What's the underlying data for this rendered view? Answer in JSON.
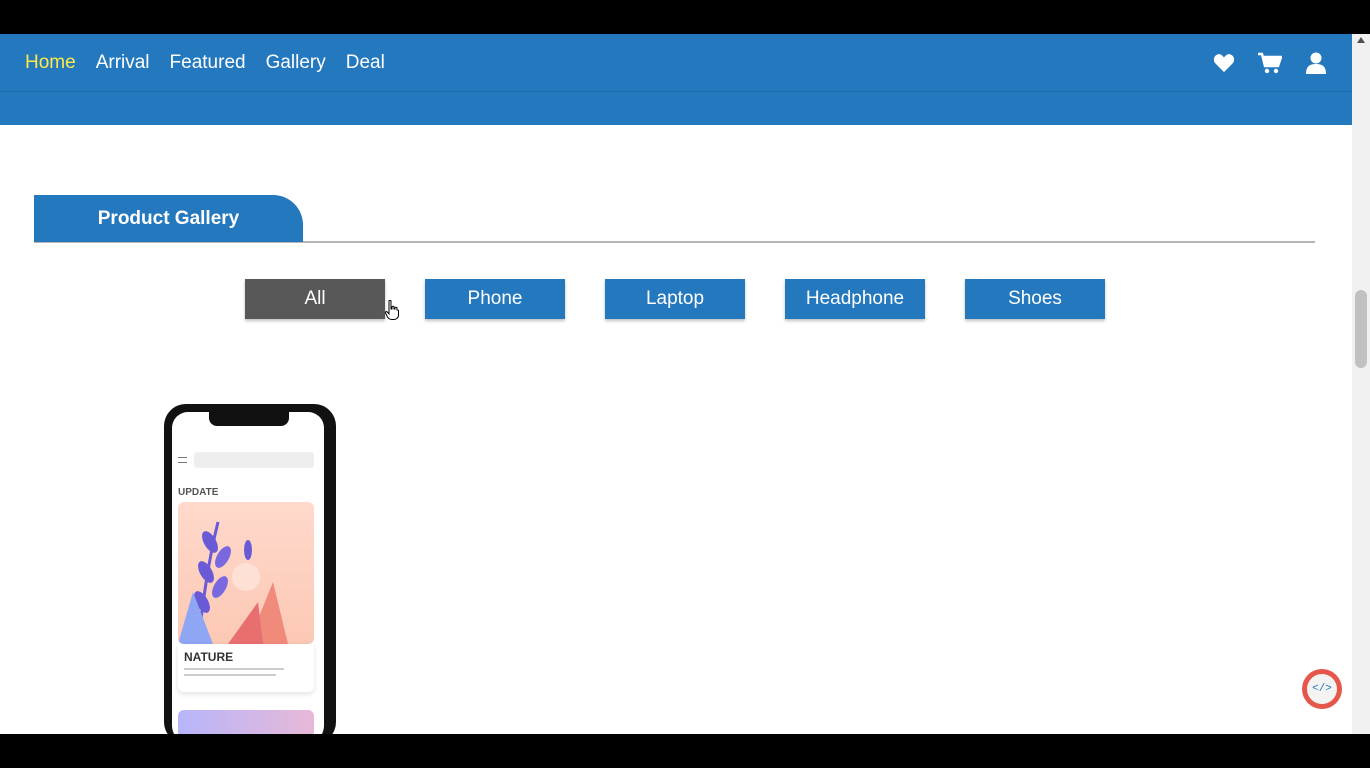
{
  "nav": {
    "links": [
      {
        "label": "Home",
        "active": true
      },
      {
        "label": "Arrival",
        "active": false
      },
      {
        "label": "Featured",
        "active": false
      },
      {
        "label": "Gallery",
        "active": false
      },
      {
        "label": "Deal",
        "active": false
      }
    ],
    "icons": [
      "heart-icon",
      "cart-icon",
      "user-icon"
    ],
    "background_color": "#2478bd",
    "active_color": "#ffe94a"
  },
  "section": {
    "title": "Product Gallery"
  },
  "filters": [
    {
      "label": "All",
      "selected": true
    },
    {
      "label": "Phone",
      "selected": false
    },
    {
      "label": "Laptop",
      "selected": false
    },
    {
      "label": "Headphone",
      "selected": false
    },
    {
      "label": "Shoes",
      "selected": false
    }
  ],
  "filter_colors": {
    "selected": "#585858",
    "default": "#2478bd"
  },
  "product": {
    "screen_title": "UPDATE",
    "caption": "NATURE"
  },
  "badge": {
    "text": "</>"
  }
}
